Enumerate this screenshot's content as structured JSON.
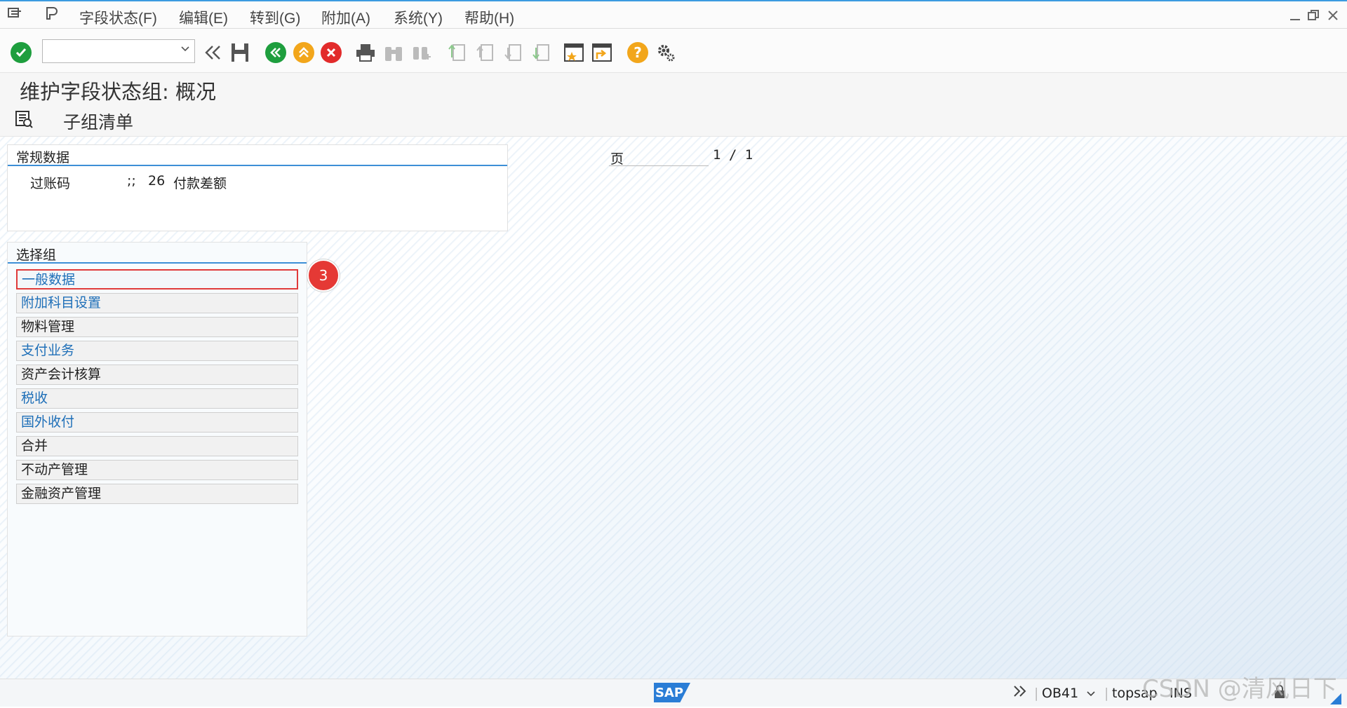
{
  "menubar": {
    "items": [
      "字段状态(F)",
      "编辑(E)",
      "转到(G)",
      "附加(A)",
      "系统(Y)",
      "帮助(H)"
    ]
  },
  "title": "维护字段状态组: 概况",
  "apptoolbar": {
    "label": "子组清单"
  },
  "general": {
    "header": "常规数据",
    "label": "过账码",
    "separator": ";;",
    "code": "26",
    "description": "付款差额"
  },
  "page": {
    "label": "页",
    "current": "1 / 1"
  },
  "selection": {
    "header": "选择组",
    "groups": [
      {
        "label": "一般数据",
        "style": "blue",
        "selected": true
      },
      {
        "label": "附加科目设置",
        "style": "blue",
        "selected": false
      },
      {
        "label": "物料管理",
        "style": "dark",
        "selected": false
      },
      {
        "label": "支付业务",
        "style": "blue",
        "selected": false
      },
      {
        "label": "资产会计核算",
        "style": "dark",
        "selected": false
      },
      {
        "label": "税收",
        "style": "blue",
        "selected": false
      },
      {
        "label": "国外收付",
        "style": "blue",
        "selected": false
      },
      {
        "label": "合并",
        "style": "dark",
        "selected": false
      },
      {
        "label": "不动产管理",
        "style": "dark",
        "selected": false
      },
      {
        "label": "金融资产管理",
        "style": "dark",
        "selected": false
      }
    ]
  },
  "annotation": {
    "step": "3"
  },
  "status": {
    "logo": "SAP",
    "transaction": "OB41",
    "server": "topsap",
    "mode": "INS"
  },
  "watermark": "CSDN @清风日下",
  "colors": {
    "accent": "#3d8fd6",
    "link": "#1e6fb8",
    "highlight": "#e03a3a",
    "ok": "#1e9e3e"
  }
}
